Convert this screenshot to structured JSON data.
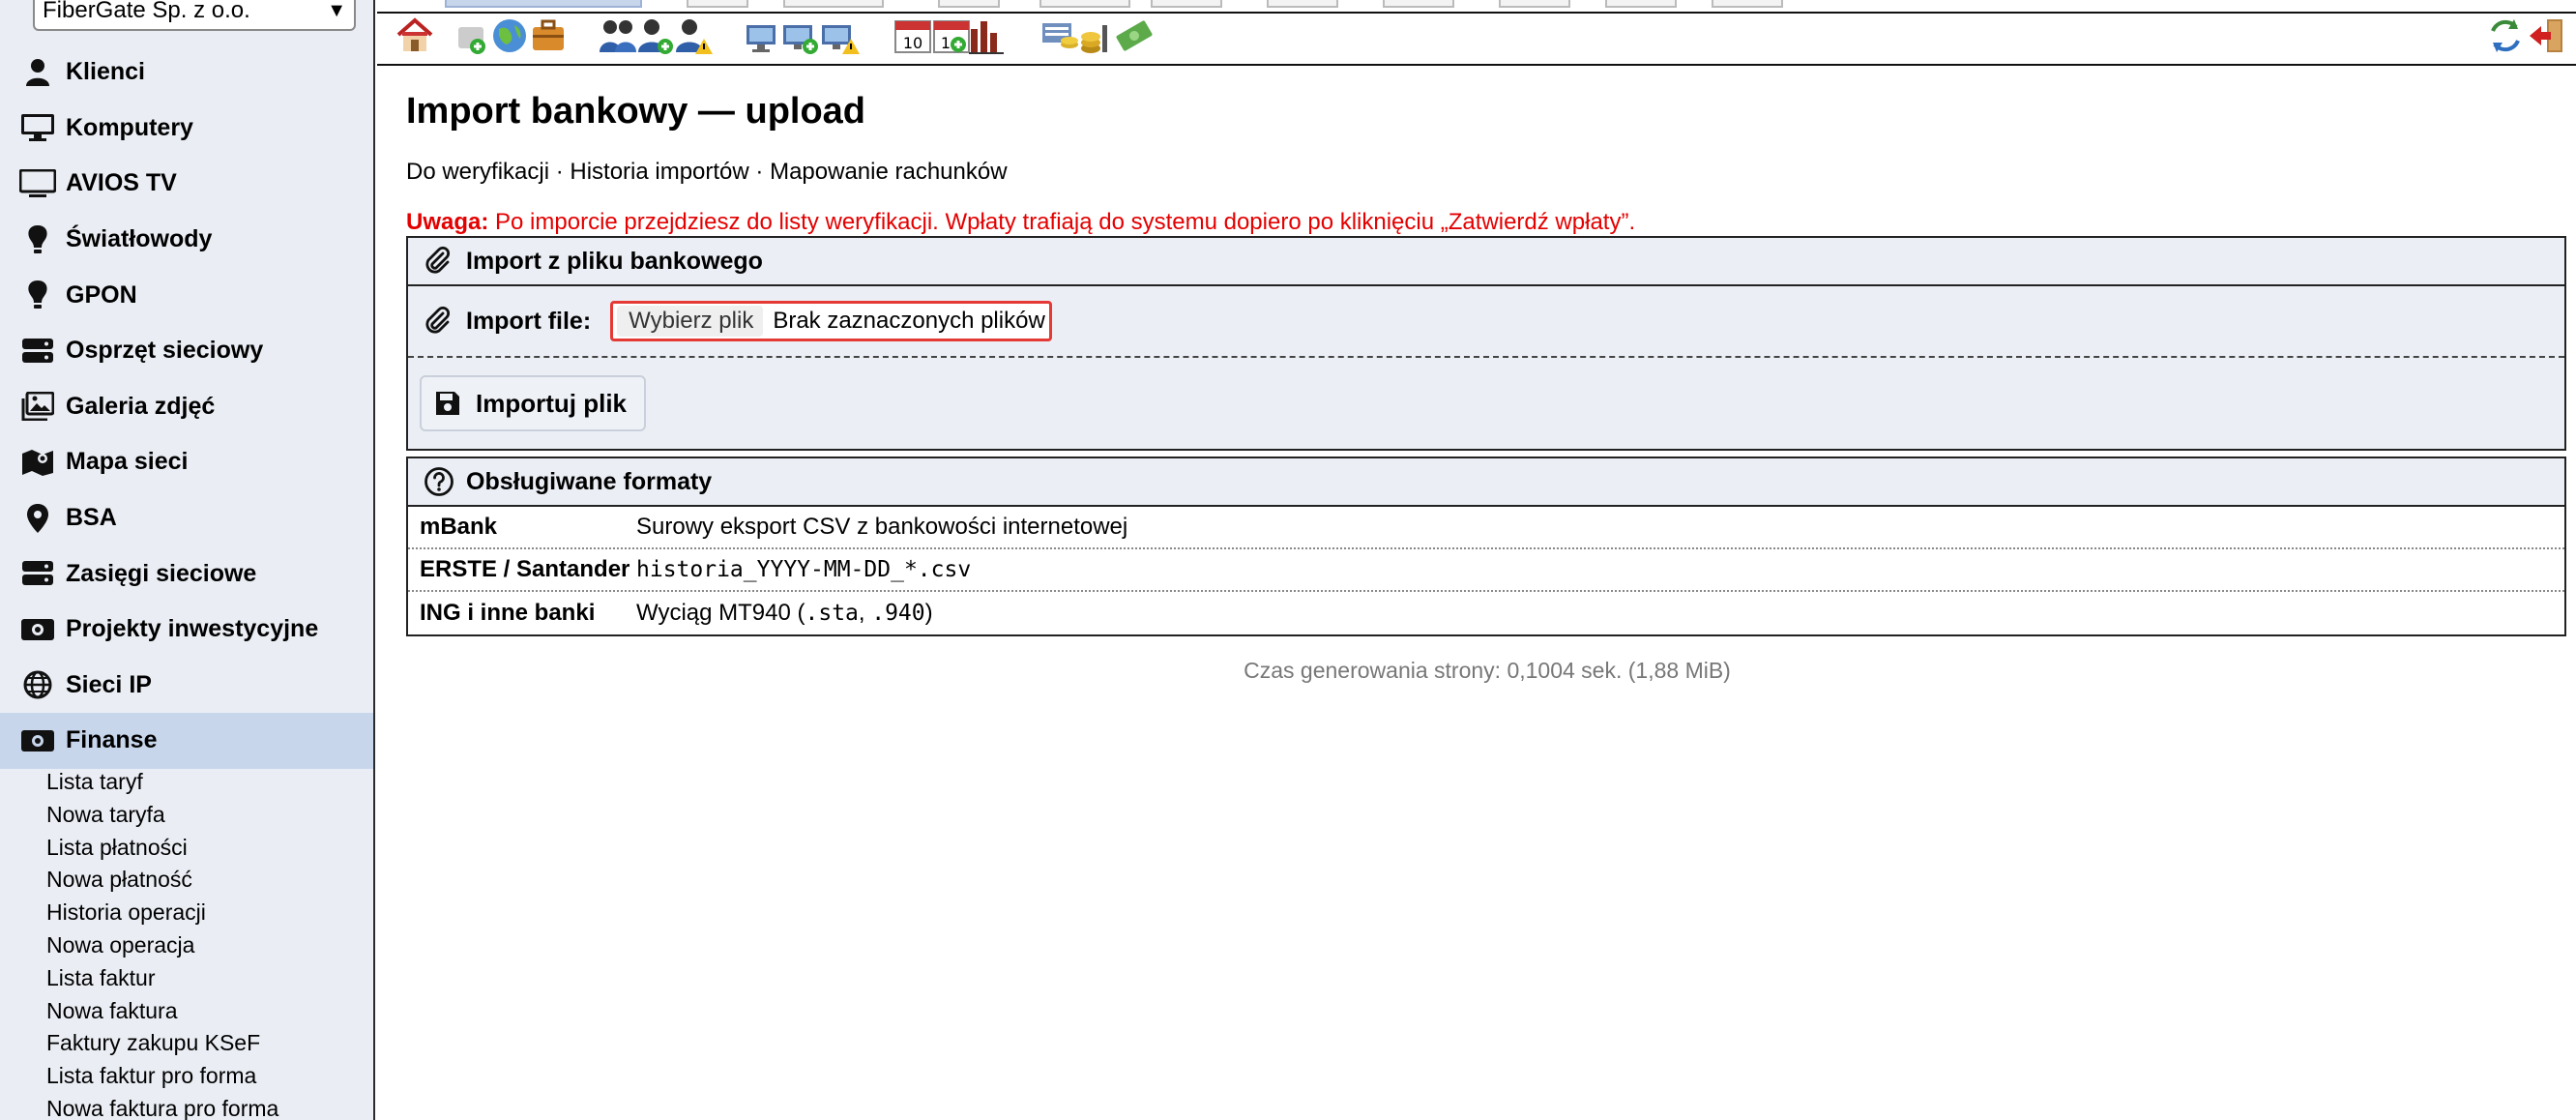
{
  "sidebar": {
    "company": "FiberGate Sp. z o.o.",
    "items": [
      {
        "label": "Klienci",
        "icon": "user-icon"
      },
      {
        "label": "Komputery",
        "icon": "monitor-icon"
      },
      {
        "label": "AVIOS TV",
        "icon": "tv-icon"
      },
      {
        "label": "Światłowody",
        "icon": "lightbulb-icon"
      },
      {
        "label": "GPON",
        "icon": "lightbulb-icon"
      },
      {
        "label": "Osprzęt sieciowy",
        "icon": "server-icon"
      },
      {
        "label": "Galeria zdjęć",
        "icon": "images-icon"
      },
      {
        "label": "Mapa sieci",
        "icon": "map-icon"
      },
      {
        "label": "BSA",
        "icon": "map-pin-icon"
      },
      {
        "label": "Zasięgi sieciowe",
        "icon": "server-icon"
      },
      {
        "label": "Projekty inwestycyjne",
        "icon": "money-icon"
      },
      {
        "label": "Sieci IP",
        "icon": "globe-icon"
      },
      {
        "label": "Finanse",
        "icon": "money-icon",
        "active": true
      }
    ],
    "finance_submenu": [
      "Lista taryf",
      "Nowa taryfa",
      "Lista płatności",
      "Nowa płatność",
      "Historia operacji",
      "Nowa operacja",
      "Lista faktur",
      "Nowa faktura",
      "Faktury zakupu KSeF",
      "Lista faktur pro forma",
      "Nowa faktura pro forma"
    ]
  },
  "page": {
    "title": "Import bankowy — upload",
    "subnav": [
      "Do weryfikacji",
      "Historia importów",
      "Mapowanie rachunków"
    ],
    "subnav_separator": " · ",
    "warning_label": "Uwaga:",
    "warning_text": " Po imporcie przejdziesz do listy weryfikacji. Wpłaty trafiają do systemu dopiero po kliknięciu „Zatwierdź wpłaty”."
  },
  "import_panel": {
    "title": "Import z pliku bankowego",
    "file_label": "Import file:",
    "file_button": "Wybierz plik",
    "file_status": "Brak zaznaczonych plików",
    "submit_label": "Importuj plik"
  },
  "formats_panel": {
    "title": "Obsługiwane formaty",
    "rows": [
      {
        "name": "mBank",
        "desc": "Surowy eksport CSV z bankowości internetowej"
      },
      {
        "name": "ERSTE / Santander",
        "desc": "historia_YYYY-MM-DD_*.csv"
      },
      {
        "name": "ING i inne banki",
        "desc_prefix": "Wyciąg MT940 (",
        "ext1": ".sta",
        "sep": ", ",
        "ext2": ".940",
        "desc_suffix": ")"
      }
    ]
  },
  "footer": "Czas generowania strony: 0,1004 sek. (1,88 MiB)",
  "colors": {
    "warning": "#e30000",
    "sidebar_bg": "#eaeef4",
    "active_item": "#c8d6ec",
    "file_box_border": "#e53935"
  }
}
